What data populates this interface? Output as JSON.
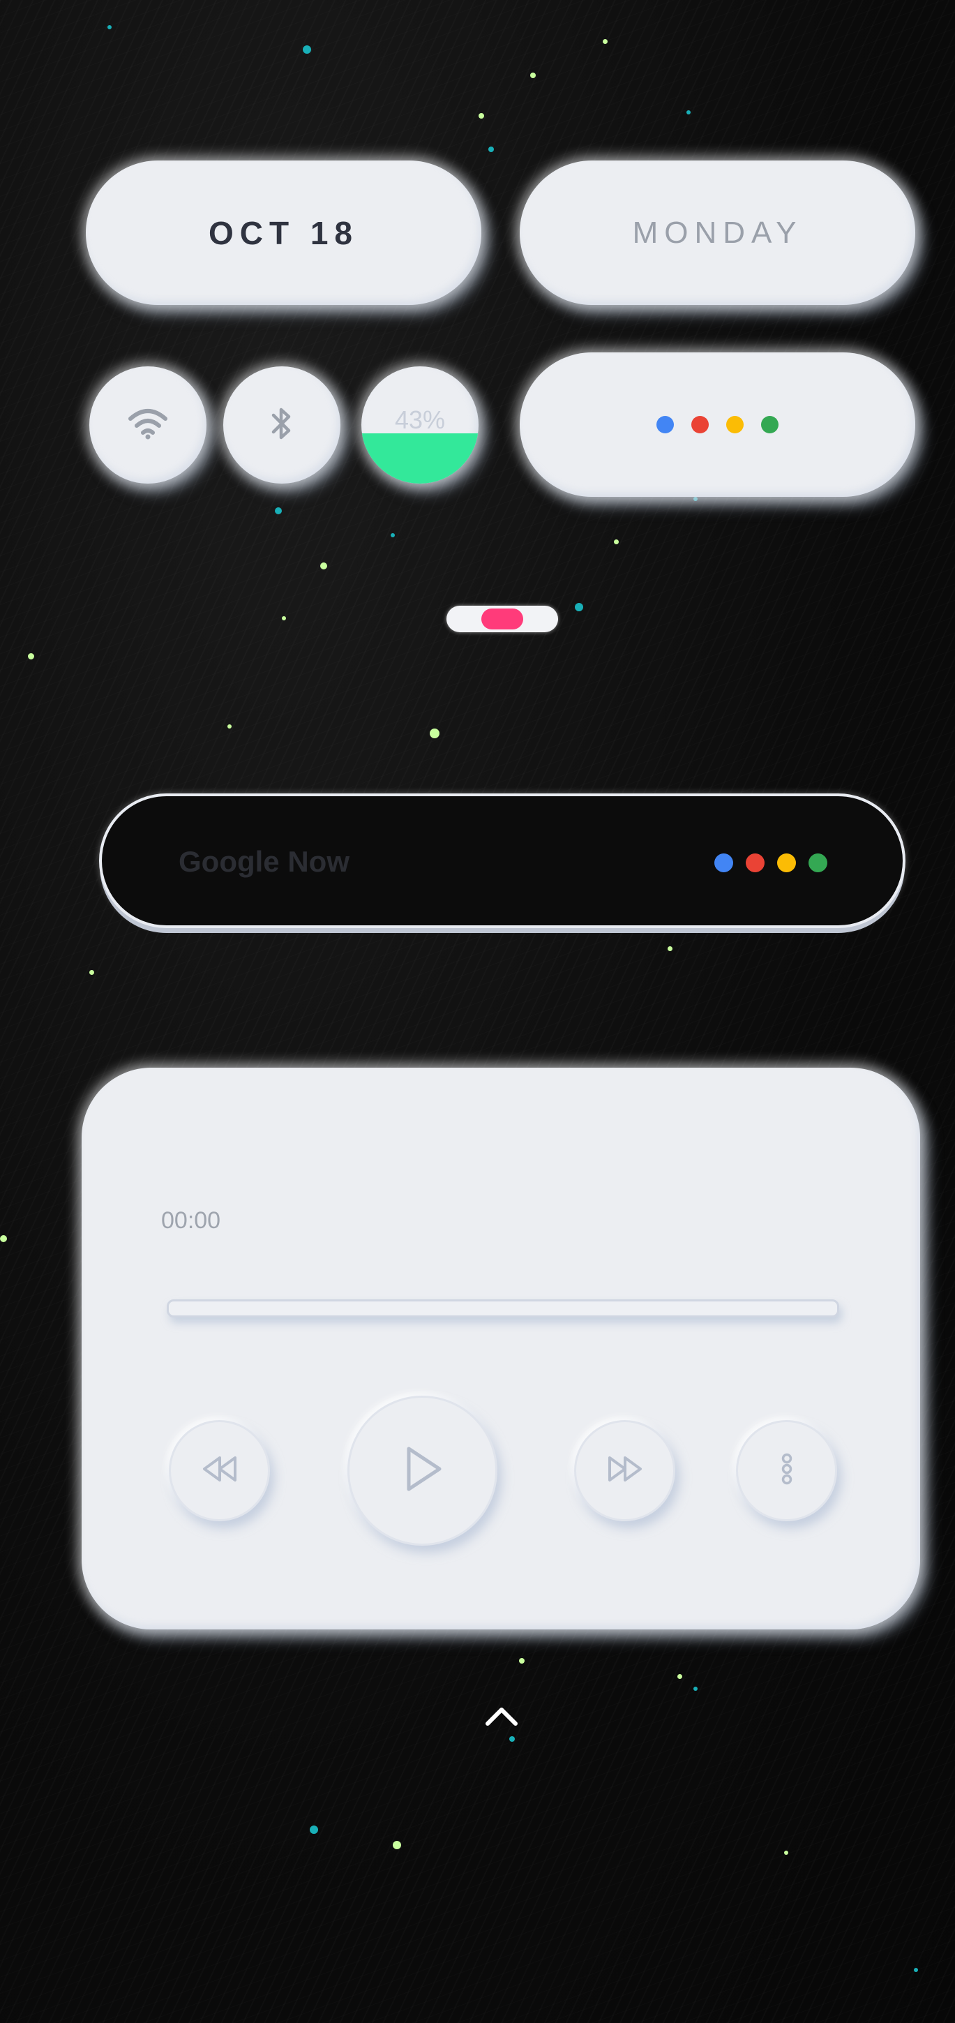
{
  "date_widget": {
    "date": "OCT 18",
    "day": "MONDAY"
  },
  "quick_toggles": {
    "wifi_icon": "wifi-icon",
    "bluetooth_icon": "bluetooth-icon",
    "battery": {
      "label": "43%",
      "level_fraction": 0.43,
      "fill_color": "#33e89a"
    }
  },
  "assistant": {
    "dot_colors": [
      "#4285f4",
      "#ea4335",
      "#fbbc05",
      "#34a853"
    ]
  },
  "toggle": {
    "accent": "#ff3b7a"
  },
  "search": {
    "placeholder": "Google Now",
    "dot_colors": [
      "#4285f4",
      "#ea4335",
      "#fbbc05",
      "#34a853"
    ]
  },
  "player": {
    "time": "00:00",
    "progress_fraction": 0,
    "controls": [
      "rewind-icon",
      "play-icon",
      "fast-forward-icon",
      "more-icon"
    ]
  },
  "footer": {
    "expand_icon": "chevron-up-icon"
  },
  "colors": {
    "background": "#0b0b0b",
    "card": "#eceef2",
    "text_dark": "#2f3340",
    "text_muted": "#9aa0aa"
  }
}
